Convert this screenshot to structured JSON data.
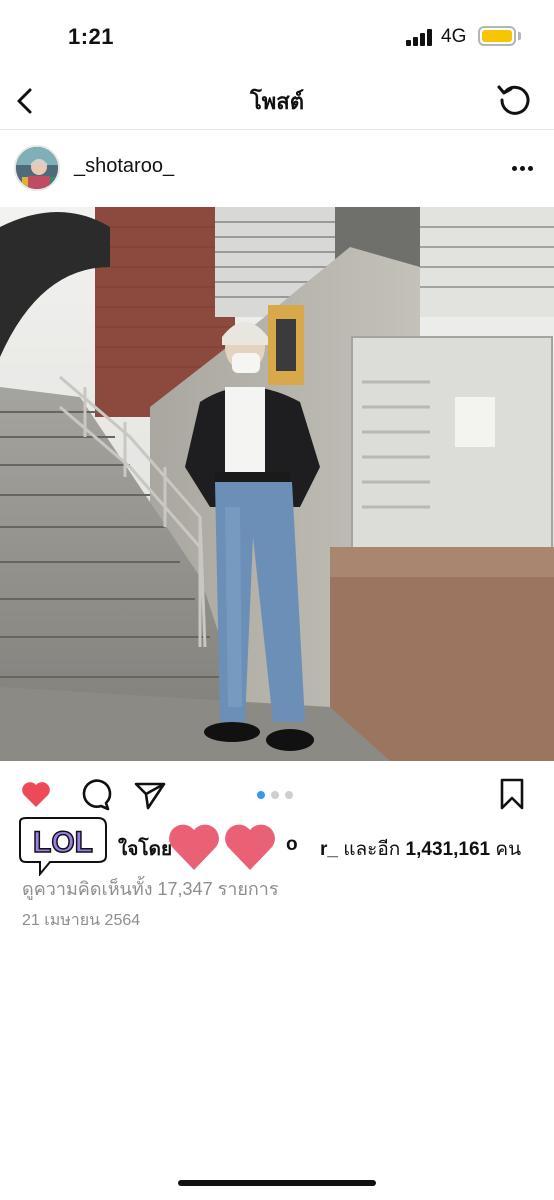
{
  "status_bar": {
    "time": "1:21",
    "network": "4G",
    "battery_color": "#f7c600"
  },
  "nav": {
    "title": "โพสต์"
  },
  "post": {
    "username": "_shotaroo_",
    "likes": {
      "prefix": "ใจโดย",
      "visible_name_fragment": "o",
      "name_tail": "r_",
      "and_more": "และอีก",
      "count": "1,431,161",
      "unit": "คน",
      "sticker_text": "LOL"
    },
    "comments_link": "ดูความคิดเห็นทั้ง 17,347 รายการ",
    "date": "21 เมษายน 2564",
    "carousel": {
      "total": 3,
      "active": 1
    }
  },
  "colors": {
    "like": "#ed4956",
    "carousel_active": "#3897f0",
    "sticker_heart": "#e8546a",
    "sticker_lol": "#9b7fe8"
  },
  "icons": [
    "back-icon",
    "refresh-icon",
    "more-icon",
    "heart-icon",
    "comment-icon",
    "share-icon",
    "save-icon"
  ]
}
